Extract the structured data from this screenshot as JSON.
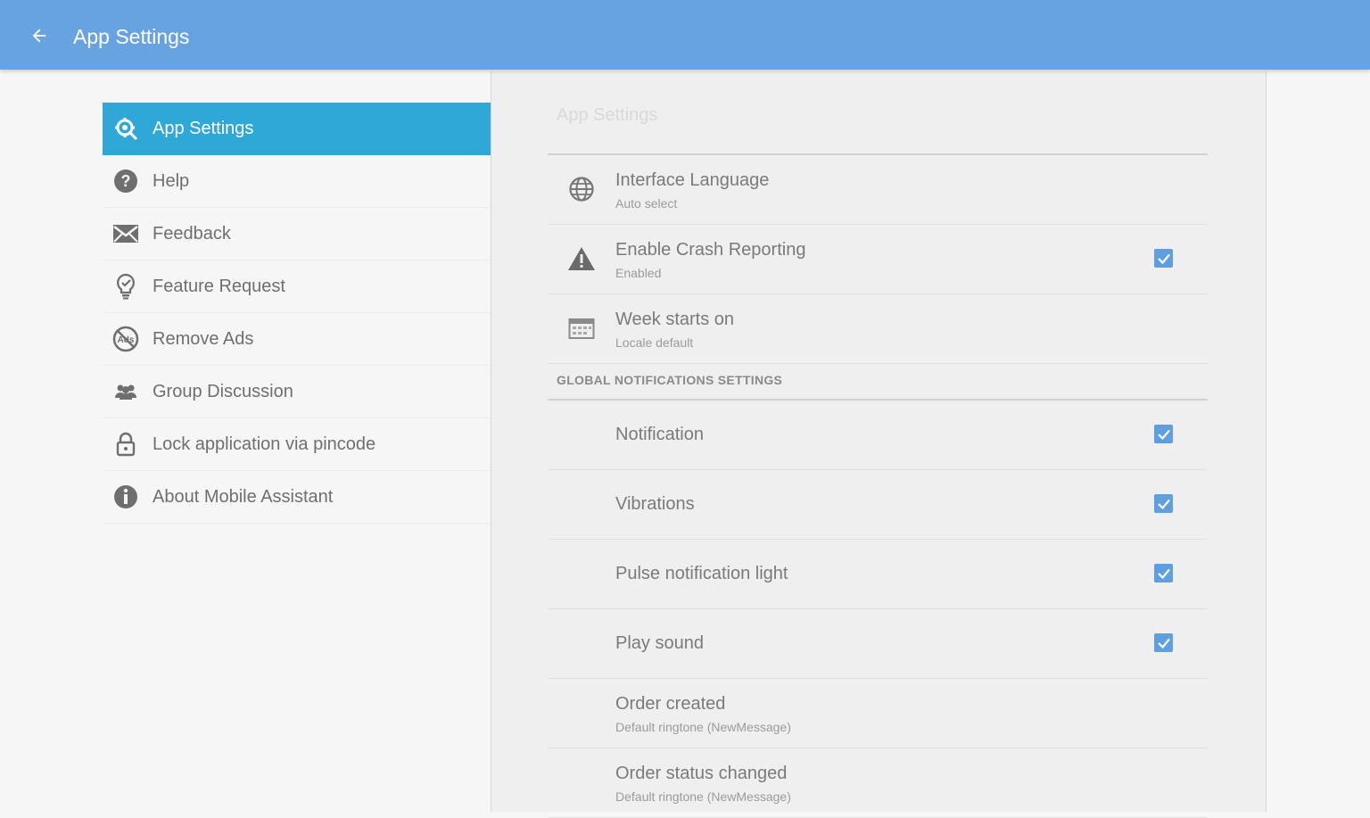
{
  "appbar": {
    "title": "App Settings",
    "back_icon": "arrow-left-icon"
  },
  "sidebar": {
    "items": [
      {
        "label": "App Settings",
        "icon": "gear-search-icon",
        "active": true
      },
      {
        "label": "Help",
        "icon": "question-circle-icon"
      },
      {
        "label": "Feedback",
        "icon": "envelope-icon"
      },
      {
        "label": "Feature Request",
        "icon": "lightbulb-icon"
      },
      {
        "label": "Remove Ads",
        "icon": "no-ads-icon"
      },
      {
        "label": "Group Discussion",
        "icon": "group-icon"
      },
      {
        "label": "Lock application via pincode",
        "icon": "lock-icon"
      },
      {
        "label": "About Mobile Assistant",
        "icon": "info-circle-icon"
      }
    ]
  },
  "panel": {
    "header": "App Settings",
    "rows": [
      {
        "title": "Interface Language",
        "subtitle": "Auto select",
        "icon": "globe-icon"
      },
      {
        "title": "Enable Crash Reporting",
        "subtitle": "Enabled",
        "icon": "warning-icon",
        "checked": true
      },
      {
        "title": "Week starts on",
        "subtitle": "Locale default",
        "icon": "calendar-icon"
      }
    ],
    "section_title": "GLOBAL NOTIFICATIONS SETTINGS",
    "notification_rows": [
      {
        "title": "Notification",
        "checked": true
      },
      {
        "title": "Vibrations",
        "checked": true
      },
      {
        "title": "Pulse notification light",
        "checked": true
      },
      {
        "title": "Play sound",
        "checked": true
      },
      {
        "title": "Order created",
        "subtitle": "Default ringtone (NewMessage)"
      },
      {
        "title": "Order status changed",
        "subtitle": "Default ringtone (NewMessage)"
      }
    ]
  },
  "colors": {
    "appbar": "#67a3e0",
    "active_item": "#2fa8d8",
    "checkbox": "#5f9fe0"
  }
}
